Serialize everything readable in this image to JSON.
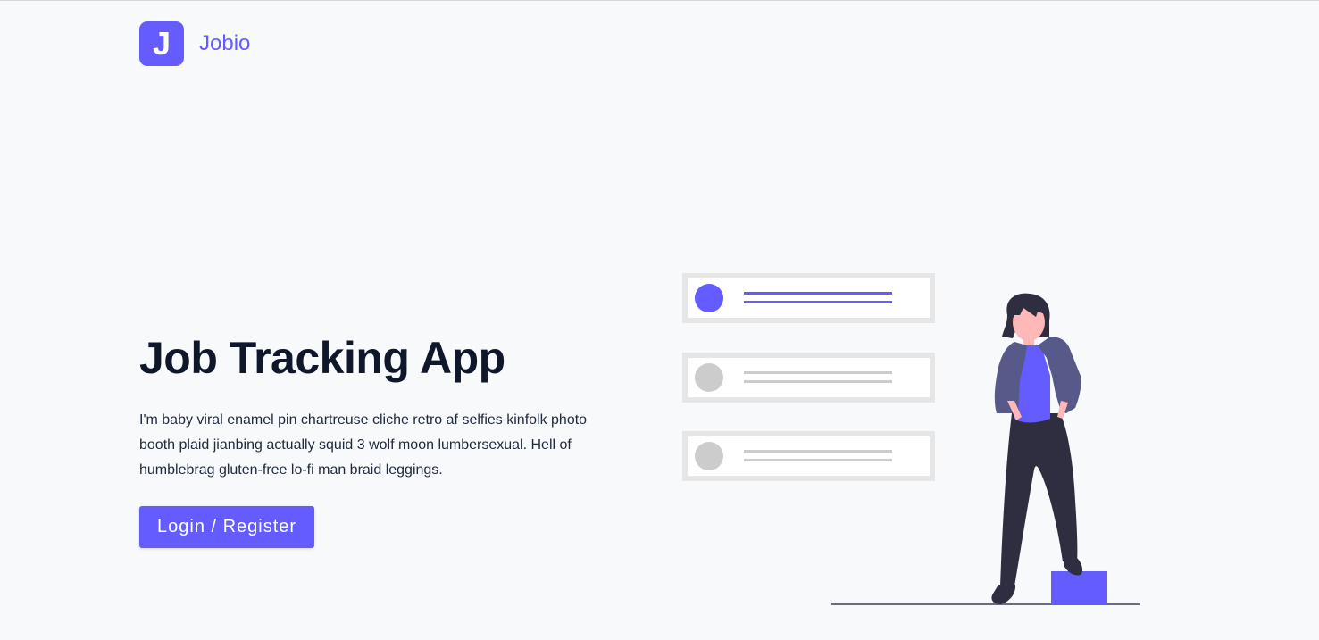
{
  "brand": {
    "logo_letter": "J",
    "name": "Jobio"
  },
  "hero": {
    "title": "Job Tracking App",
    "description": "I'm baby viral enamel pin chartreuse cliche retro af selfies kinfolk photo booth plaid jianbing actually squid 3 wolf moon lumbersexual. Hell of humblebrag gluten-free lo-fi man braid leggings.",
    "cta_label": "Login / Register"
  },
  "colors": {
    "primary": "#645cff",
    "title": "#0f172a",
    "background": "#f8f9fb",
    "card_border": "#e6e6e6",
    "inactive_gray": "#cccccc",
    "jacket": "#575a89",
    "pants": "#2f2e41",
    "skin": "#ffb8b8"
  }
}
